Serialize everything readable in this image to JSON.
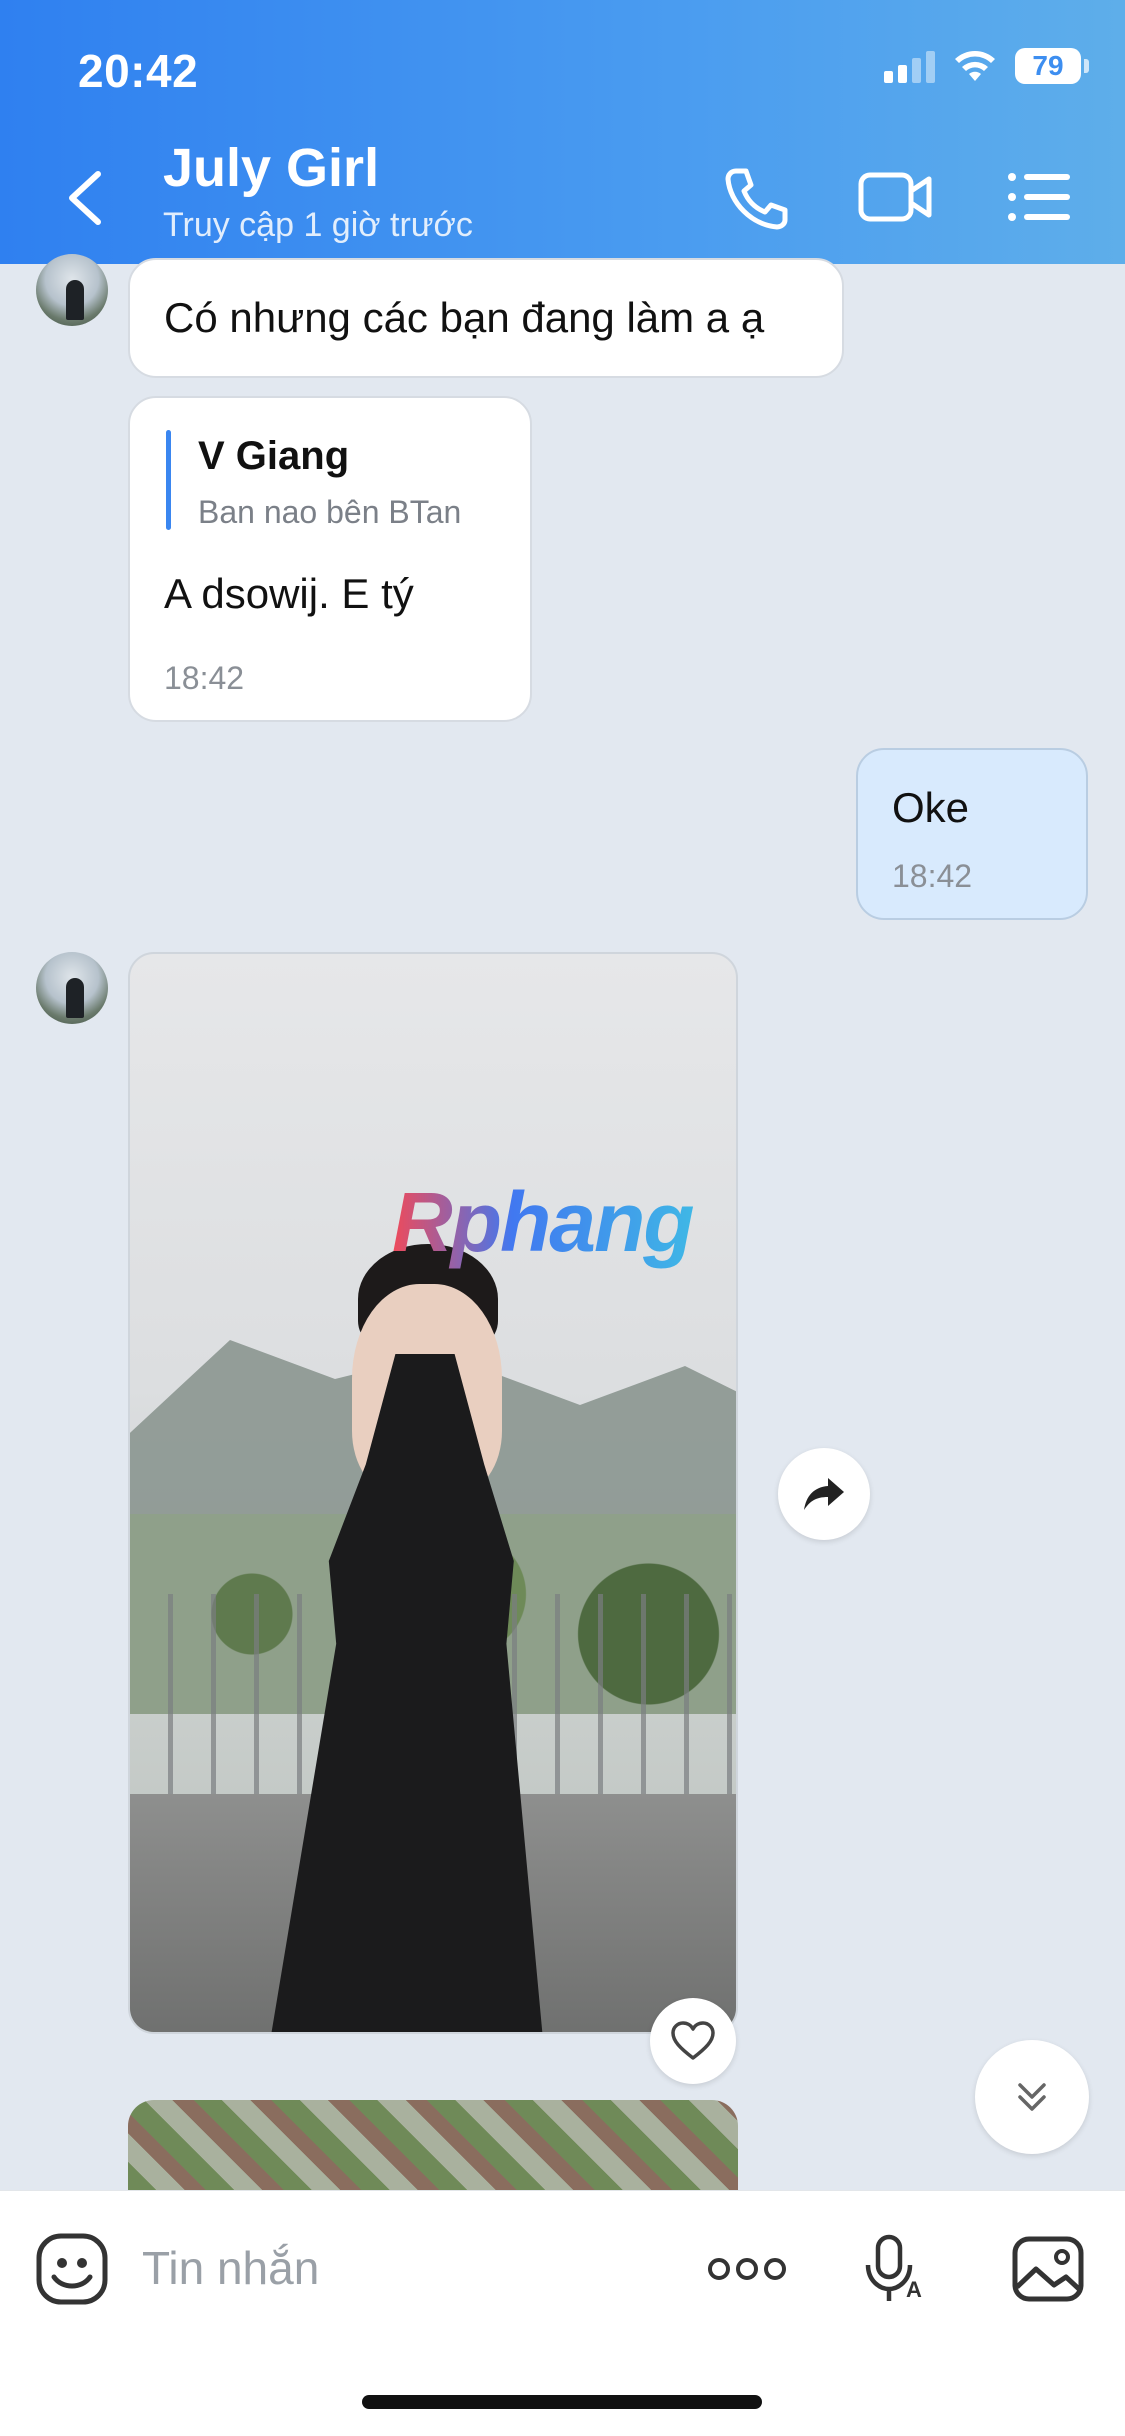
{
  "status_bar": {
    "time": "20:42",
    "battery": "79"
  },
  "header": {
    "title": "July Girl",
    "subtitle": "Truy cập 1 giờ trước"
  },
  "messages": [
    {
      "direction": "in",
      "text": "Có nhưng các bạn đang làm a ạ"
    },
    {
      "direction": "in",
      "quote": {
        "author": "V Giang",
        "text": "Ban nao bên BTan"
      },
      "text": "A dsowij.  E tý",
      "time": "18:42"
    },
    {
      "direction": "out",
      "text": "Oke",
      "time": "18:42"
    },
    {
      "direction": "in",
      "type": "photo",
      "watermark": "Rphang"
    }
  ],
  "composer": {
    "placeholder": "Tin nhắn"
  },
  "colors": {
    "header_start": "#2f80f0",
    "header_end": "#5eaeea",
    "outgoing_bubble": "#d8eafd",
    "background": "#e2e8f0"
  },
  "icons": [
    "back-icon",
    "phone-icon",
    "video-call-icon",
    "menu-list-icon",
    "share-forward-icon",
    "heart-icon",
    "scroll-down-icon",
    "sticker-icon",
    "more-icon",
    "voice-icon",
    "image-icon"
  ]
}
